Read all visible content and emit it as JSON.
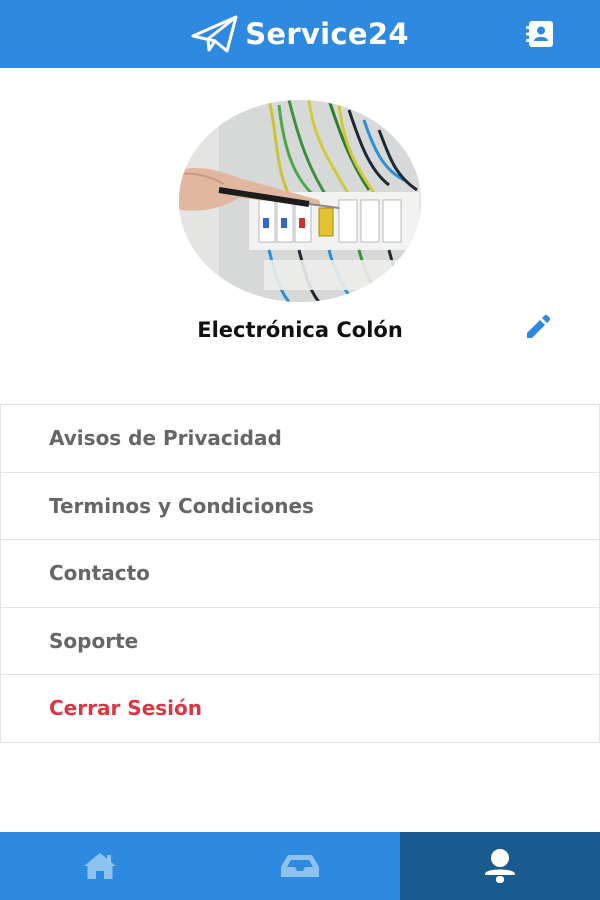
{
  "header": {
    "brand_name": "Service24",
    "logo_icon": "paper-plane-icon",
    "contacts_icon": "address-book-icon"
  },
  "profile": {
    "name": "Electrónica Colón",
    "edit_icon": "pencil-icon",
    "photo": "electrical-panel-photo"
  },
  "menu": {
    "items": [
      {
        "label": "Avisos de Privacidad"
      },
      {
        "label": "Terminos y Condiciones"
      },
      {
        "label": "Contacto"
      },
      {
        "label": "Soporte"
      },
      {
        "label": "Cerrar Sesión"
      }
    ]
  },
  "bottom_nav": {
    "tabs": [
      {
        "icon": "home-icon",
        "active": false
      },
      {
        "icon": "inbox-icon",
        "active": false
      },
      {
        "icon": "user-icon",
        "active": true
      }
    ]
  },
  "colors": {
    "primary": "#2d8ae0",
    "nav_active": "#1a5b8f",
    "menu_text": "#666666",
    "logout": "#dc3545",
    "icon_muted": "#8ec3f0"
  }
}
